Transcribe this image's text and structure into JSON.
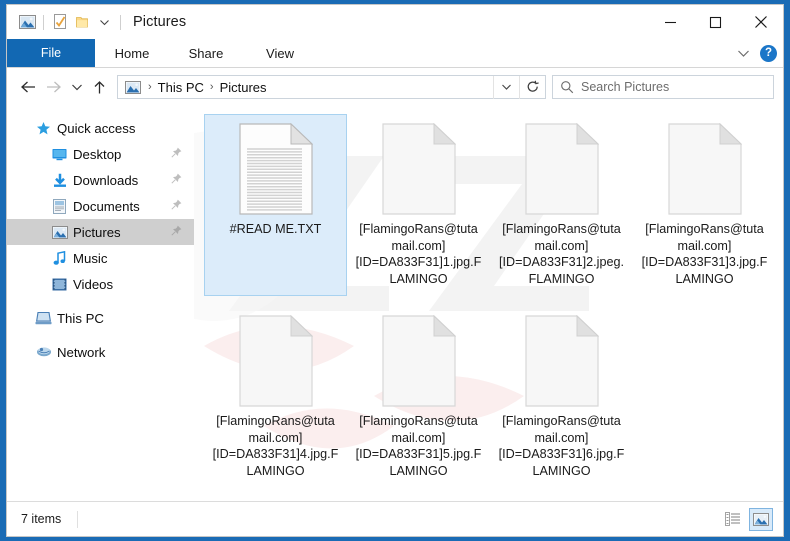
{
  "window": {
    "title": "Pictures",
    "quick_access_icons": [
      "pictures-library-icon",
      "properties-icon",
      "new-folder-icon",
      "customize-dropdown-icon"
    ],
    "controls": {
      "minimize": "minimize-icon",
      "maximize": "maximize-icon",
      "close": "close-icon"
    }
  },
  "ribbon": {
    "tabs": [
      {
        "label": "File",
        "active": true
      },
      {
        "label": "Home",
        "active": false
      },
      {
        "label": "Share",
        "active": false
      },
      {
        "label": "View",
        "active": false
      }
    ],
    "collapse_icon": "chevron-down-icon",
    "help_label": "?"
  },
  "address": {
    "back_icon": "back-arrow-icon",
    "forward_icon": "forward-arrow-icon",
    "recent_icon": "recent-locations-icon",
    "up_icon": "up-arrow-icon",
    "path_icon": "pictures-folder-icon",
    "breadcrumbs": [
      "This PC",
      "Pictures"
    ],
    "separator": "›",
    "dropdown_icon": "chevron-down-icon",
    "refresh_icon": "refresh-icon"
  },
  "search": {
    "icon": "search-icon",
    "placeholder": "Search Pictures"
  },
  "sidebar": {
    "items": [
      {
        "label": "Quick access",
        "icon": "star-icon",
        "indent": false,
        "pinned": false,
        "selected": false
      },
      {
        "label": "Desktop",
        "icon": "desktop-icon",
        "indent": true,
        "pinned": true,
        "selected": false
      },
      {
        "label": "Downloads",
        "icon": "downloads-icon",
        "indent": true,
        "pinned": true,
        "selected": false
      },
      {
        "label": "Documents",
        "icon": "documents-icon",
        "indent": true,
        "pinned": true,
        "selected": false
      },
      {
        "label": "Pictures",
        "icon": "pictures-icon",
        "indent": true,
        "pinned": true,
        "selected": true
      },
      {
        "label": "Music",
        "icon": "music-icon",
        "indent": true,
        "pinned": false,
        "selected": false
      },
      {
        "label": "Videos",
        "icon": "videos-icon",
        "indent": true,
        "pinned": false,
        "selected": false
      },
      {
        "label": "This PC",
        "icon": "this-pc-icon",
        "indent": false,
        "pinned": false,
        "selected": false
      },
      {
        "label": "Network",
        "icon": "network-icon",
        "indent": false,
        "pinned": false,
        "selected": false
      }
    ]
  },
  "files": [
    {
      "name": "#READ ME.TXT",
      "icon": "text-file-icon",
      "selected": true
    },
    {
      "name": "[FlamingoRans@tutamail.com][ID=DA833F31]1.jpg.FLAMINGO",
      "icon": "blank-file-icon",
      "selected": false
    },
    {
      "name": "[FlamingoRans@tutamail.com][ID=DA833F31]2.jpeg.FLAMINGO",
      "icon": "blank-file-icon",
      "selected": false
    },
    {
      "name": "[FlamingoRans@tutamail.com][ID=DA833F31]3.jpg.FLAMINGO",
      "icon": "blank-file-icon",
      "selected": false
    },
    {
      "name": "[FlamingoRans@tutamail.com][ID=DA833F31]4.jpg.FLAMINGO",
      "icon": "blank-file-icon",
      "selected": false
    },
    {
      "name": "[FlamingoRans@tutamail.com][ID=DA833F31]5.jpg.FLAMINGO",
      "icon": "blank-file-icon",
      "selected": false
    },
    {
      "name": "[FlamingoRans@tutamail.com][ID=DA833F31]6.jpg.FLAMINGO",
      "icon": "blank-file-icon",
      "selected": false
    }
  ],
  "status": {
    "item_count": "7 items",
    "details_view_icon": "details-view-icon",
    "large_icons_view_icon": "large-icons-view-icon",
    "active_view": "large-icons-view-icon"
  },
  "colors": {
    "accent": "#1268b3",
    "window_frame": "#1a6bb5",
    "selection_fill": "#dcecfa",
    "selection_border": "#a8d2f0",
    "nav_selected": "#cfcfcf"
  }
}
